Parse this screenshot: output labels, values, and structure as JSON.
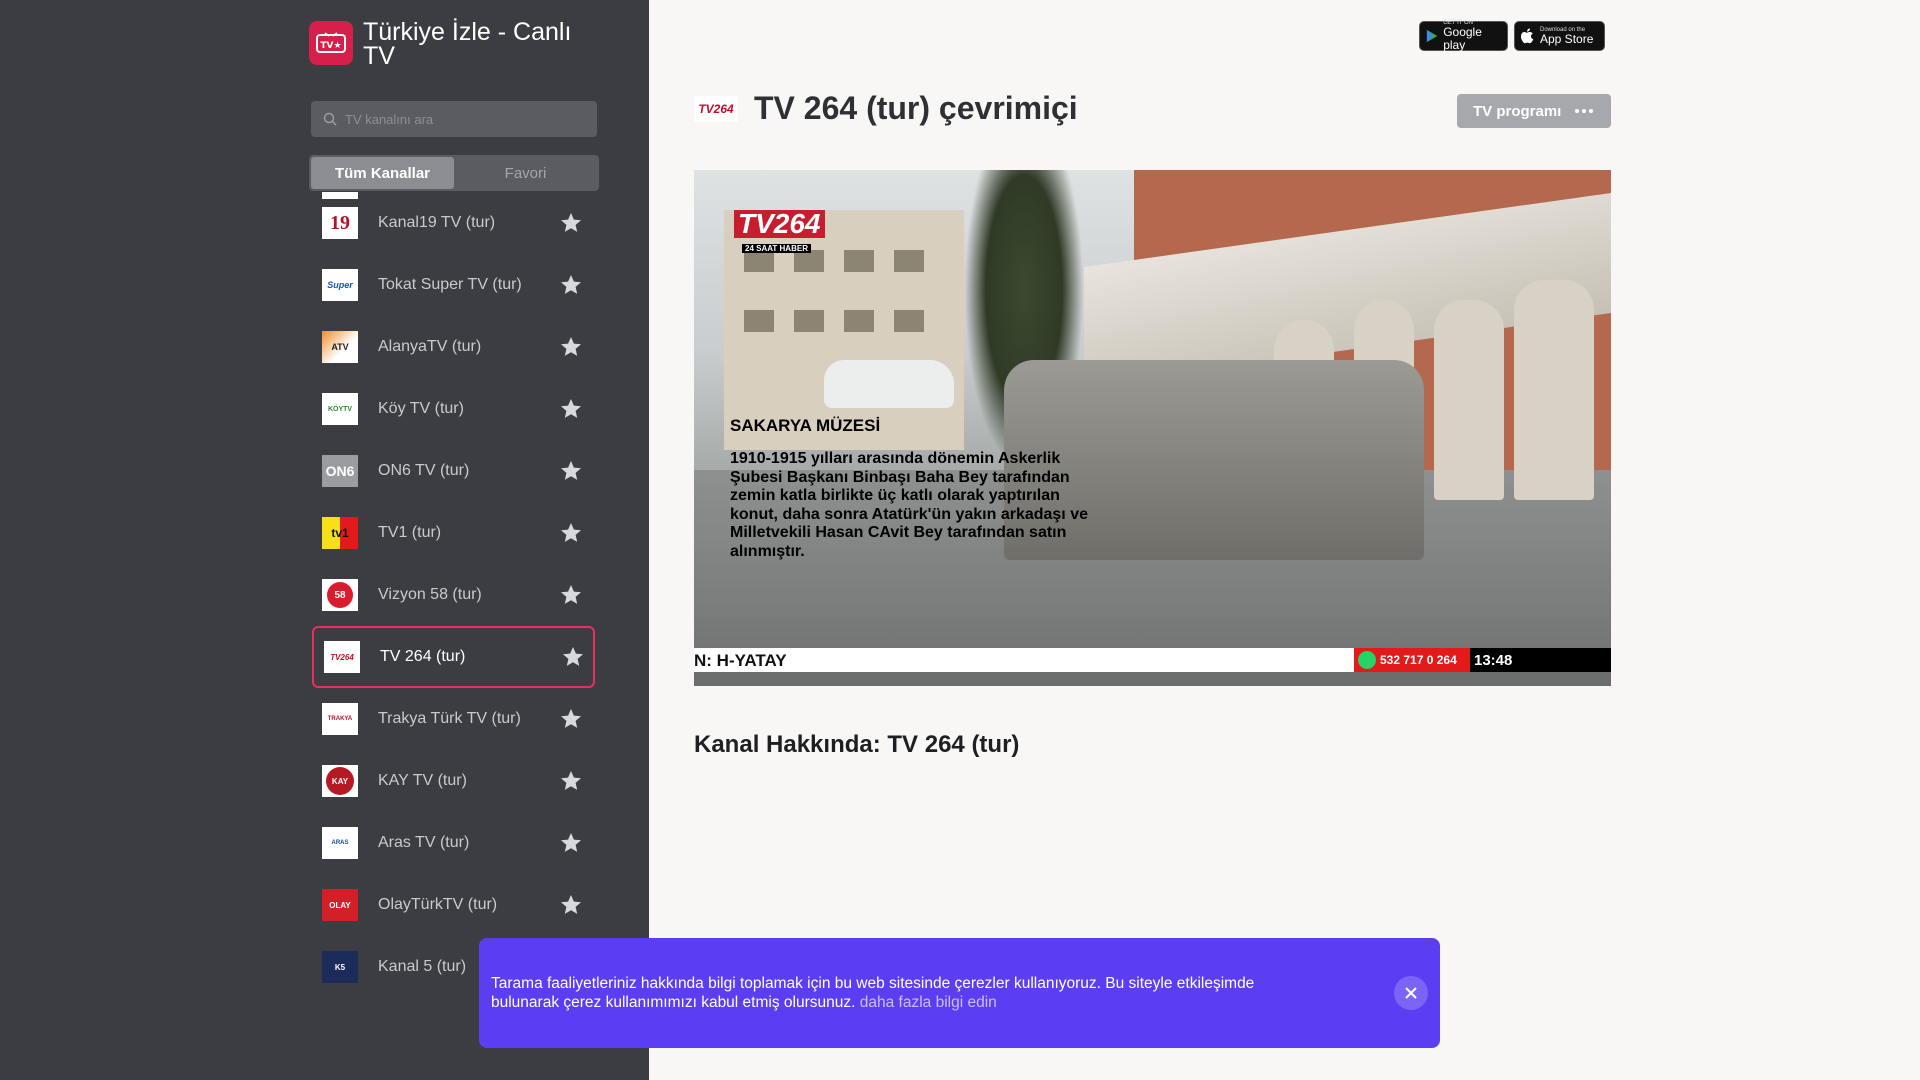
{
  "app": {
    "title": "Türkiye İzle - Canlı TV",
    "logo_text": "TV★"
  },
  "search": {
    "placeholder": "TV kanalını ara"
  },
  "tabs": [
    {
      "label": "Tüm Kanallar",
      "active": true
    },
    {
      "label": "Favori",
      "active": false
    }
  ],
  "channels": [
    {
      "name": "Kanal19 TV (tur)",
      "logo": "19",
      "active": false
    },
    {
      "name": "Tokat Super TV (tur)",
      "logo": "Super",
      "active": false
    },
    {
      "name": "AlanyaTV (tur)",
      "logo": "ATV",
      "active": false
    },
    {
      "name": "Köy TV (tur)",
      "logo": "KÖYTV",
      "active": false
    },
    {
      "name": "ON6 TV (tur)",
      "logo": "ON6",
      "active": false
    },
    {
      "name": "TV1 (tur)",
      "logo": "tv1",
      "active": false
    },
    {
      "name": "Vizyon 58 (tur)",
      "logo": "58",
      "active": false
    },
    {
      "name": "TV 264 (tur)",
      "logo": "TV264",
      "active": true
    },
    {
      "name": "Trakya Türk TV (tur)",
      "logo": "TRAKYA",
      "active": false
    },
    {
      "name": "KAY TV (tur)",
      "logo": "KAY",
      "active": false
    },
    {
      "name": "Aras TV (tur)",
      "logo": "ARAS",
      "active": false
    },
    {
      "name": "OlayTürkTV (tur)",
      "logo": "OLAY",
      "active": false
    },
    {
      "name": "Kanal 5 (tur)",
      "logo": "K5",
      "active": false
    }
  ],
  "stores": {
    "google_small": "GET IT ON",
    "google_big": "Google play",
    "apple_small": "Download on the",
    "apple_big": "App Store"
  },
  "main": {
    "channel_logo": "TV264",
    "title": "TV 264 (tur) çevrimiçi",
    "tv_program_label": "TV programı",
    "about": "Kanal Hakkında: TV 264 (tur)"
  },
  "video": {
    "logo_main": "TV264",
    "logo_sub": "24 SAAT HABER",
    "caption_title": "SAKARYA MÜZESİ",
    "caption_body": "1910-1915 yılları arasında dönemin Askerlik Şubesi Başkanı Binbaşı Baha Bey tarafından zemin katla birlikte üç katlı olarak yaptırılan konut, daha sonra Atatürk'ün yakın arkadaşı ve Milletvekili Hasan CAvit Bey tarafından satın alınmıştır.",
    "ticker": "N: H-YATAY",
    "phone": "532 717 0 264",
    "clock": "13:48"
  },
  "cookie": {
    "text": "Tarama faaliyetleriniz hakkında bilgi toplamak için bu web sitesinde çerezler kullanıyoruz. Bu siteyle etkileşimde bulunarak çerez kullanımımızı kabul etmiş olursunuz.",
    "link": "daha fazla bilgi edin"
  },
  "colors": {
    "sidebar_bg": "#3b3d42",
    "accent": "#e8305a",
    "cookie_bg": "#5b3ef2",
    "page_bg": "#f8f7f5"
  }
}
